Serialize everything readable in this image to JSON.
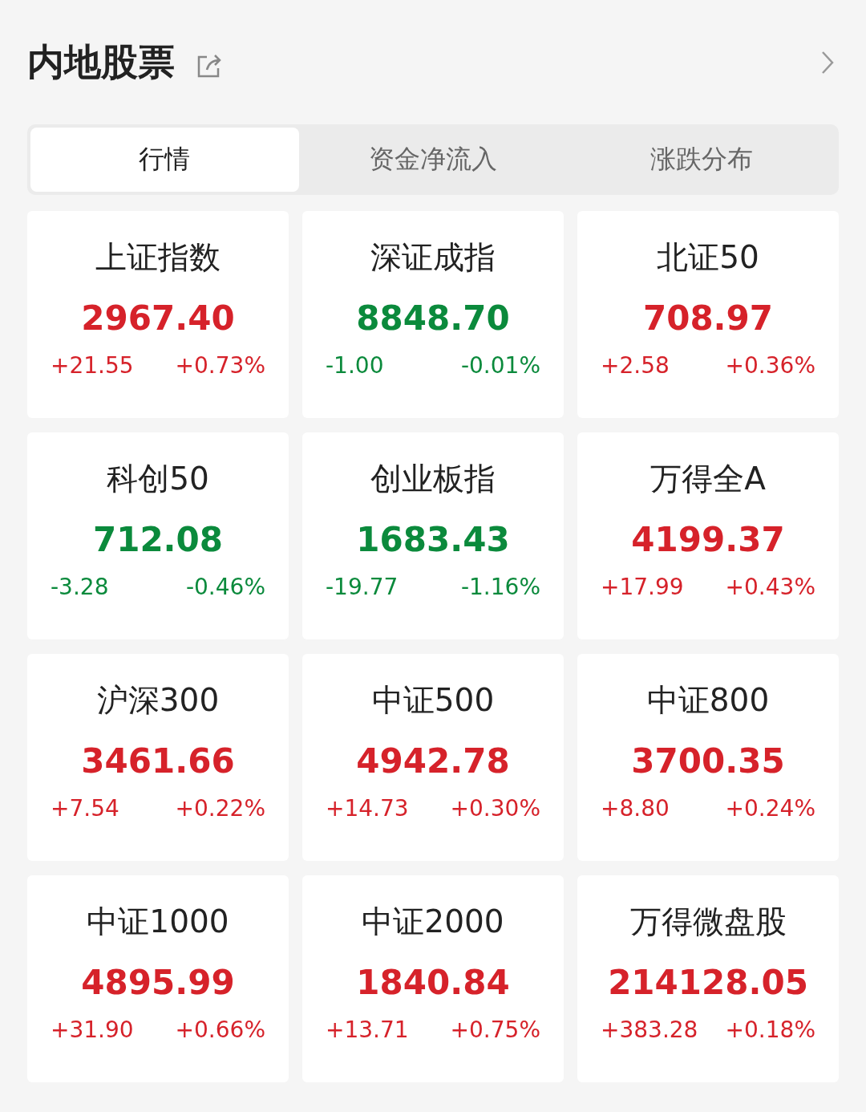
{
  "header": {
    "title": "内地股票"
  },
  "tabs": [
    {
      "label": "行情",
      "selected": true
    },
    {
      "label": "资金净流入",
      "selected": false
    },
    {
      "label": "涨跌分布",
      "selected": false
    }
  ],
  "indices": [
    {
      "name": "上证指数",
      "value": "2967.40",
      "change": "+21.55",
      "percent": "+0.73%",
      "color": "#d6222a"
    },
    {
      "name": "深证成指",
      "value": "8848.70",
      "change": "-1.00",
      "percent": "-0.01%",
      "color": "#0b8a3c"
    },
    {
      "name": "北证50",
      "value": "708.97",
      "change": "+2.58",
      "percent": "+0.36%",
      "color": "#d6222a"
    },
    {
      "name": "科创50",
      "value": "712.08",
      "change": "-3.28",
      "percent": "-0.46%",
      "color": "#0b8a3c"
    },
    {
      "name": "创业板指",
      "value": "1683.43",
      "change": "-19.77",
      "percent": "-1.16%",
      "color": "#0b8a3c"
    },
    {
      "name": "万得全A",
      "value": "4199.37",
      "change": "+17.99",
      "percent": "+0.43%",
      "color": "#d6222a"
    },
    {
      "name": "沪深300",
      "value": "3461.66",
      "change": "+7.54",
      "percent": "+0.22%",
      "color": "#d6222a"
    },
    {
      "name": "中证500",
      "value": "4942.78",
      "change": "+14.73",
      "percent": "+0.30%",
      "color": "#d6222a"
    },
    {
      "name": "中证800",
      "value": "3700.35",
      "change": "+8.80",
      "percent": "+0.24%",
      "color": "#d6222a"
    },
    {
      "name": "中证1000",
      "value": "4895.99",
      "change": "+31.90",
      "percent": "+0.66%",
      "color": "#d6222a"
    },
    {
      "name": "中证2000",
      "value": "1840.84",
      "change": "+13.71",
      "percent": "+0.75%",
      "color": "#d6222a"
    },
    {
      "name": "万得微盘股",
      "value": "214128.05",
      "change": "+383.28",
      "percent": "+0.18%",
      "color": "#d6222a"
    }
  ]
}
